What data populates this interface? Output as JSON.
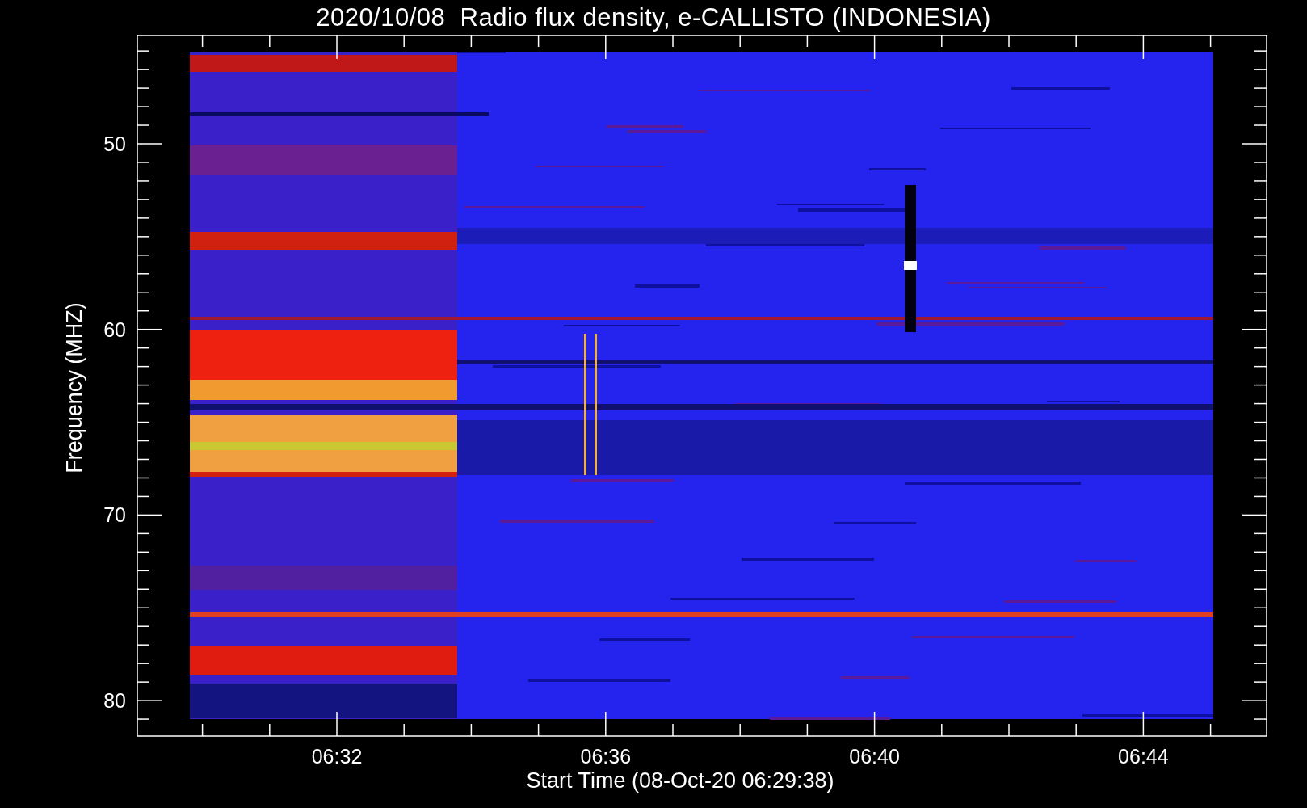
{
  "plot": {
    "title": "2020/10/08  Radio flux density, e-CALLISTO (INDONESIA)",
    "xlabel": "Start Time (08-Oct-20 06:29:38)",
    "ylabel": "Frequency (MHZ)",
    "yticks": [
      "50",
      "60",
      "70",
      "80"
    ],
    "xticks": [
      "06:32",
      "06:36",
      "06:40",
      "06:44"
    ]
  }
}
